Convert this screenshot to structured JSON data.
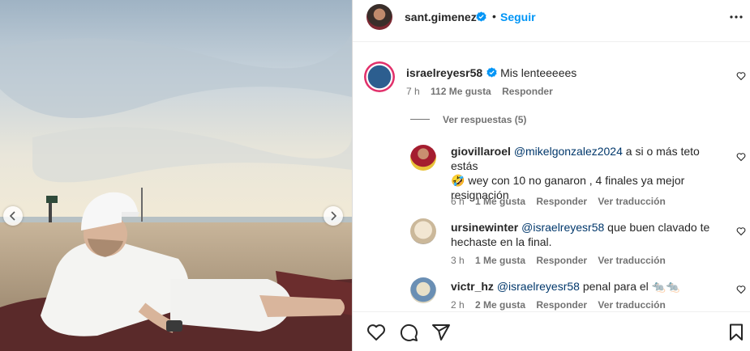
{
  "post": {
    "username": "sant.gimenez",
    "separator": "•",
    "follow_label": "Seguir",
    "more_icon": "more-horizontal-icon"
  },
  "comments": [
    {
      "username": "israelreyesr58",
      "verified": true,
      "text": "Mis lenteeeees",
      "time": "7 h",
      "likes": "112 Me gusta",
      "reply_label": "Responder"
    }
  ],
  "view_replies": "Ver respuestas (5)",
  "replies": [
    {
      "username": "giovillaroel",
      "mention": "@mikelgonzalez2024",
      "text_line1": " a si o más teto estás",
      "emoji": "🤣",
      "text_line2": " wey con 10 no ganaron , 4 finales ya mejor",
      "text_line3": "resignación",
      "time": "6 h",
      "likes": "1 Me gusta",
      "reply_label": "Responder",
      "translate_label": "Ver traducción"
    },
    {
      "username": "ursinewinter",
      "mention": "@israelreyesr58",
      "text_line1": " que buen clavado te",
      "text_line2": "hechaste en la final.",
      "time": "3 h",
      "likes": "1 Me gusta",
      "reply_label": "Responder",
      "translate_label": "Ver traducción"
    },
    {
      "username": "victr_hz",
      "mention": "@israelreyesr58",
      "text_line1": " penal para el ",
      "emoji": "🐀🐀",
      "time": "2 h",
      "likes": "2 Me gusta",
      "reply_label": "Responder",
      "translate_label": "Ver traducción"
    }
  ],
  "colors": {
    "accent": "#0095f6",
    "verified": "#0095f6",
    "mention": "#00376b",
    "meta": "#737373"
  },
  "icons": [
    "heart-icon",
    "comment-icon",
    "share-icon",
    "bookmark-icon",
    "chevron-left-icon",
    "chevron-right-icon",
    "verified-badge-icon"
  ]
}
